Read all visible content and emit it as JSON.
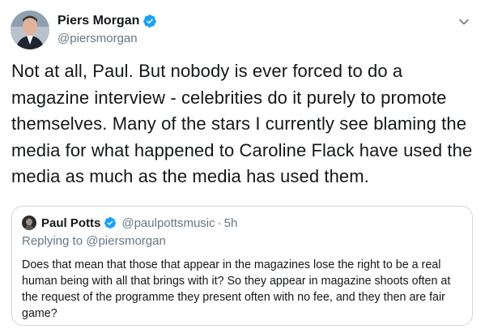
{
  "tweet": {
    "author": {
      "display_name": "Piers Morgan",
      "handle": "@piersmorgan",
      "verified": true
    },
    "text": "Not at all, Paul. But nobody is ever forced to do a magazine interview - celebrities do it purely to promote themselves. Many of the stars I currently see blaming the media for what happened to Caroline Flack have used the media as much as the media has used them.",
    "menu_icon": "chevron-down-icon"
  },
  "quoted_tweet": {
    "author": {
      "display_name": "Paul Potts",
      "handle": "@paulpottsmusic",
      "verified": true
    },
    "separator": "·",
    "time": "5h",
    "replying_prefix": "Replying to ",
    "replying_to": "@piersmorgan",
    "text": "Does that mean that those that appear in the magazines lose the right to be a real human being with all that brings with it?  So they appear in magazine shoots often at the request of the programme they present often with no fee, and they then are fair game?"
  },
  "colors": {
    "text": "#14171a",
    "secondary": "#657786",
    "verified_badge": "#1da1f2",
    "border": "#ccd6dd"
  }
}
